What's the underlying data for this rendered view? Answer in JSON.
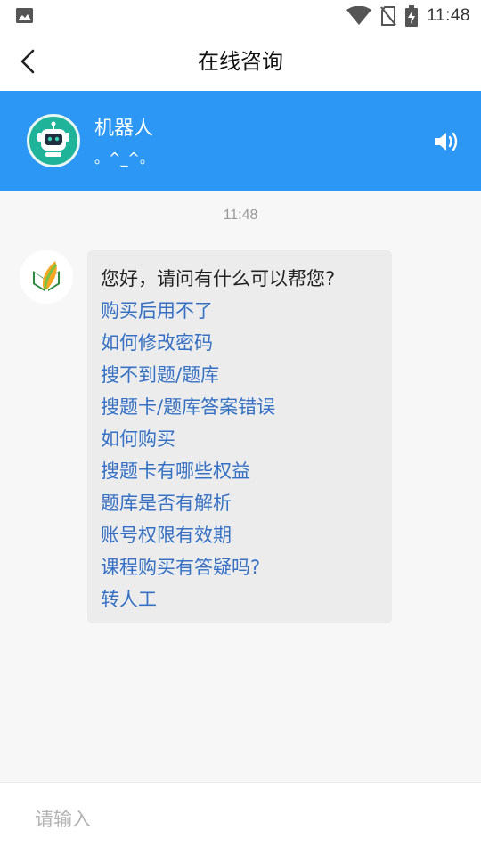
{
  "status_bar": {
    "time": "11:48",
    "icons": [
      "image-notification-icon",
      "wifi-icon",
      "no-sim-icon",
      "battery-charging-icon"
    ]
  },
  "header": {
    "title": "在线咨询",
    "back_icon": "back-arrow-icon"
  },
  "robot": {
    "name": "机器人",
    "mood": "。^_^。",
    "avatar_icon": "robot-icon",
    "speaker_icon": "speaker-icon"
  },
  "chat": {
    "timestamp": "11:48",
    "bot_avatar_icon": "leaf-book-logo-icon",
    "greeting": "您好，请问有什么可以帮您?",
    "options": [
      "购买后用不了",
      "如何修改密码",
      "搜不到题/题库",
      "搜题卡/题库答案错误",
      "如何购买",
      "搜题卡有哪些权益",
      "题库是否有解析",
      "账号权限有效期",
      "课程购买有答疑吗?",
      "转人工"
    ]
  },
  "input": {
    "placeholder": "请输入",
    "value": ""
  },
  "colors": {
    "banner": "#2c97f4",
    "robot_avatar": "#1fb49a",
    "link": "#3570c4"
  }
}
